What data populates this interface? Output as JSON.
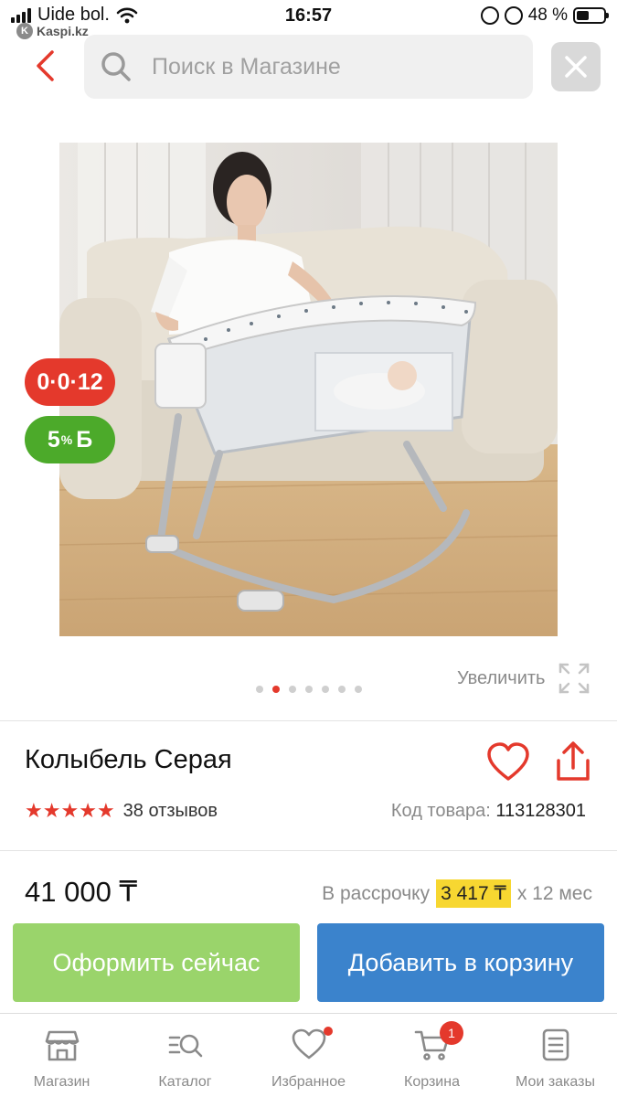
{
  "status_bar": {
    "carrier": "Uide bol.",
    "time": "16:57",
    "battery": "48 %",
    "battery_level": 0.48,
    "back_app": "Kaspi.kz"
  },
  "header": {
    "search_placeholder": "Поиск в Магазине",
    "back_icon": "chevron-left-icon",
    "close_icon": "close-icon"
  },
  "gallery": {
    "image_count": 7,
    "active_index": 1,
    "zoom_label": "Увеличить"
  },
  "badges": {
    "installment": "0·0·12",
    "bonus_value": "5",
    "bonus_pct": "%",
    "bonus_symbol": "Б"
  },
  "product": {
    "title": "Колыбель Серая",
    "rating_stars": 5,
    "reviews": "38 отзывов",
    "sku_label": "Код товара:",
    "sku": "113128301",
    "price": "41 000 ₸",
    "installment_label": "В рассрочку",
    "installment_amount": "3 417 ₸",
    "installment_term": "х 12 мес"
  },
  "actions": {
    "buy_now": "Оформить сейчас",
    "add_to_cart": "Добавить в корзину"
  },
  "tabbar": {
    "items": [
      {
        "label": "Магазин",
        "icon": "store-icon"
      },
      {
        "label": "Каталог",
        "icon": "catalog-search-icon"
      },
      {
        "label": "Избранное",
        "icon": "heart-icon"
      },
      {
        "label": "Корзина",
        "icon": "cart-icon"
      },
      {
        "label": "Мои заказы",
        "icon": "orders-icon"
      }
    ],
    "cart_count": "1"
  },
  "colors": {
    "accent_red": "#e4392c",
    "buy_green": "#9ad46b",
    "cart_blue": "#3b83cc",
    "bonus_green": "#4caa2a",
    "highlight_yellow": "#f7d731"
  }
}
